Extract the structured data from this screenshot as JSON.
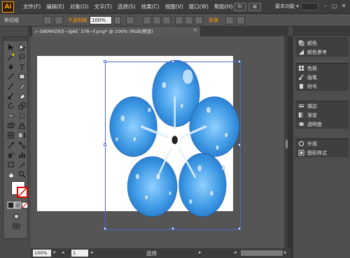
{
  "app": {
    "logo": "Ai"
  },
  "menu": {
    "items": [
      "文件(F)",
      "编辑(E)",
      "对象(O)",
      "文字(T)",
      "选择(S)",
      "效果(C)",
      "视图(V)",
      "窗口(W)",
      "帮助(H)"
    ],
    "workspace": "基本功能",
    "workspace_arrow": "▾"
  },
  "controlbar": {
    "tool_label": "剪切组",
    "opacity_label": "不透明度",
    "opacity_value": "100%",
    "transform_label": "变换"
  },
  "document": {
    "tab_title": "/--S8[MHZ6](~$JAE`378~F.png* @ 100% (RGB/预览)",
    "close": "×"
  },
  "status": {
    "zoom": "100%",
    "page": "1",
    "tool_name": "选择"
  },
  "panels": {
    "group1": [
      {
        "label": "颜色",
        "icon": "color-icon"
      },
      {
        "label": "颜色参考",
        "icon": "color-guide-icon"
      }
    ],
    "group2": [
      {
        "label": "色板",
        "icon": "swatches-icon"
      },
      {
        "label": "画笔",
        "icon": "brushes-icon"
      },
      {
        "label": "符号",
        "icon": "symbols-icon"
      }
    ],
    "group3": [
      {
        "label": "描边",
        "icon": "stroke-icon"
      },
      {
        "label": "渐变",
        "icon": "gradient-icon"
      },
      {
        "label": "透明度",
        "icon": "transparency-icon"
      }
    ],
    "group4": [
      {
        "label": "外观",
        "icon": "appearance-icon"
      },
      {
        "label": "图形样式",
        "icon": "graphic-styles-icon"
      }
    ]
  },
  "colors": {
    "accent": "#ff9a00",
    "selection": "#4a6ad0",
    "flower": "#4aa4e8"
  }
}
